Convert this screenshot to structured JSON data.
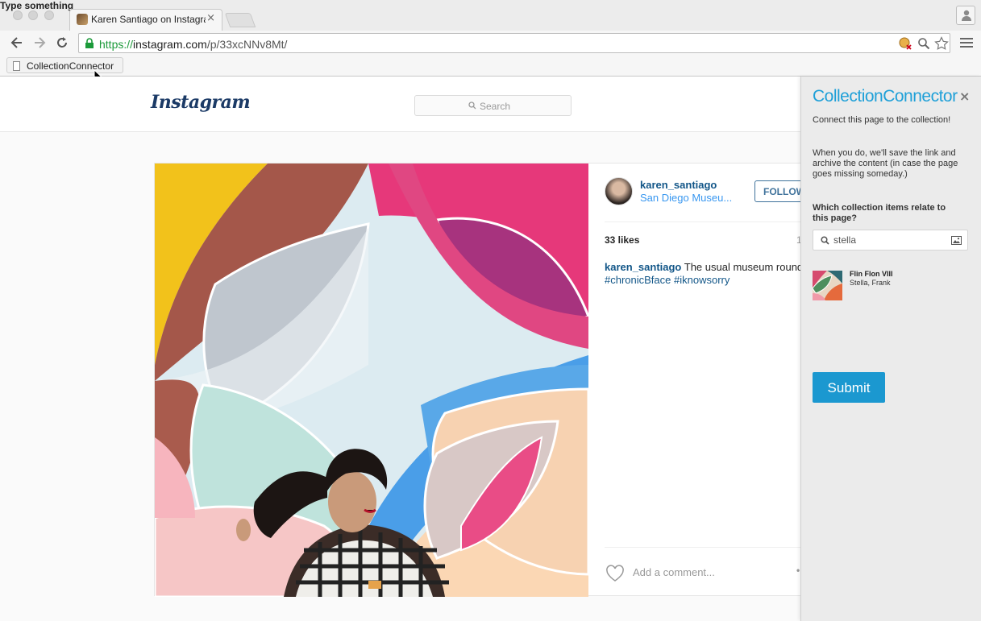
{
  "window": {
    "title": "Type something"
  },
  "browser": {
    "tab": {
      "title": "Karen Santiago on Instagra",
      "close": "×"
    },
    "url": {
      "scheme": "https://",
      "host": "instagram.com",
      "path": "/p/33xcNNv8Mt/"
    },
    "bookmark": {
      "label": "CollectionConnector"
    }
  },
  "instagram": {
    "logo": "Instagram",
    "search_placeholder": "Search",
    "post": {
      "username": "karen_santiago",
      "location": "San Diego Museu...",
      "follow_label": "FOLLOW",
      "likes": "33 likes",
      "time_ago": "1",
      "caption_user": "karen_santiago",
      "caption_text": " The usual museum round",
      "caption_tags": "#chronicBface #iknowsorry",
      "comment_placeholder": "Add a comment...",
      "more": "•"
    }
  },
  "extension": {
    "title": "CollectionConnector",
    "close": "×",
    "desc1": "Connect this page to the collection!",
    "desc2": "When you do, we'll save the link and archive the content (in case the page goes missing someday.)",
    "question": "Which collection items relate to this page?",
    "search_value": "stella",
    "result": {
      "title": "Flin Flon VIII",
      "artist": "Stella, Frank"
    },
    "submit_label": "Submit"
  },
  "colors": {
    "accent": "#1fa0d8",
    "submit": "#1b98d0",
    "ig_link": "#125688",
    "ig_location": "#3897f0"
  }
}
